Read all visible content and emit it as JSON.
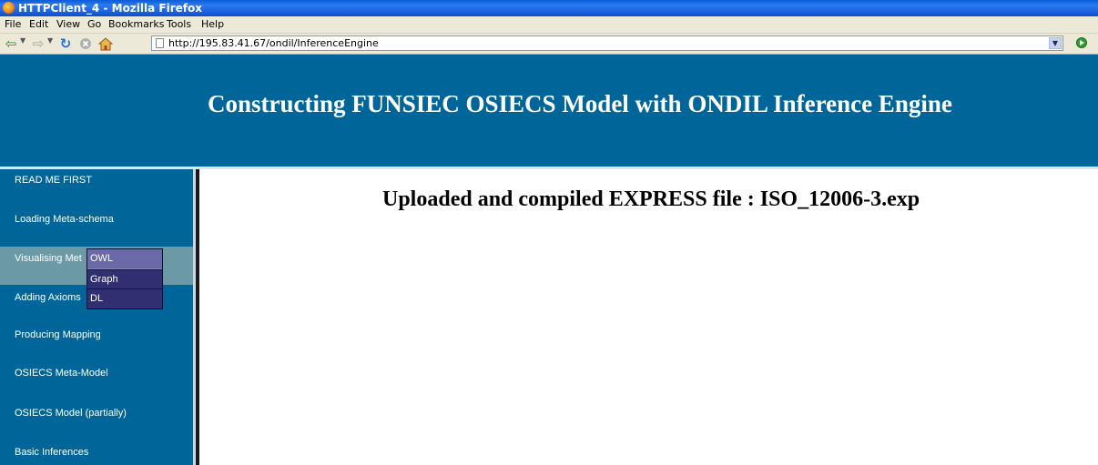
{
  "window": {
    "title": "HTTPClient_4 - Mozilla Firefox"
  },
  "menu": [
    "File",
    "Edit",
    "View",
    "Go",
    "Bookmarks",
    "Tools",
    "Help"
  ],
  "navbar": {
    "url": "http://195.83.41.67/ondil/InferenceEngine",
    "icons": [
      "back-icon",
      "forward-icon",
      "reload-icon",
      "stop-icon",
      "home-icon",
      "page-icon",
      "go-icon"
    ]
  },
  "page": {
    "header_title": "Constructing FUNSIEC OSIECS Model with ONDIL Inference Engine",
    "main_heading": "Uploaded and compiled EXPRESS file : ISO_12006-3.exp",
    "header_bg": "#006699",
    "active_bg": "#6b9aa6"
  },
  "sidebar": [
    {
      "label": "READ ME FIRST"
    },
    {
      "label": "Loading Meta-schema"
    },
    {
      "label": "Visualising Met"
    },
    {
      "label": "Adding Axioms"
    },
    {
      "label": "Producing Mapping"
    },
    {
      "label": "OSIECS Meta-Model"
    },
    {
      "label": "OSIECS Model (partially)"
    },
    {
      "label": "Basic Inferences"
    }
  ],
  "submenu": [
    {
      "label": "OWL"
    },
    {
      "label": "Graph"
    },
    {
      "label": "DL"
    }
  ]
}
